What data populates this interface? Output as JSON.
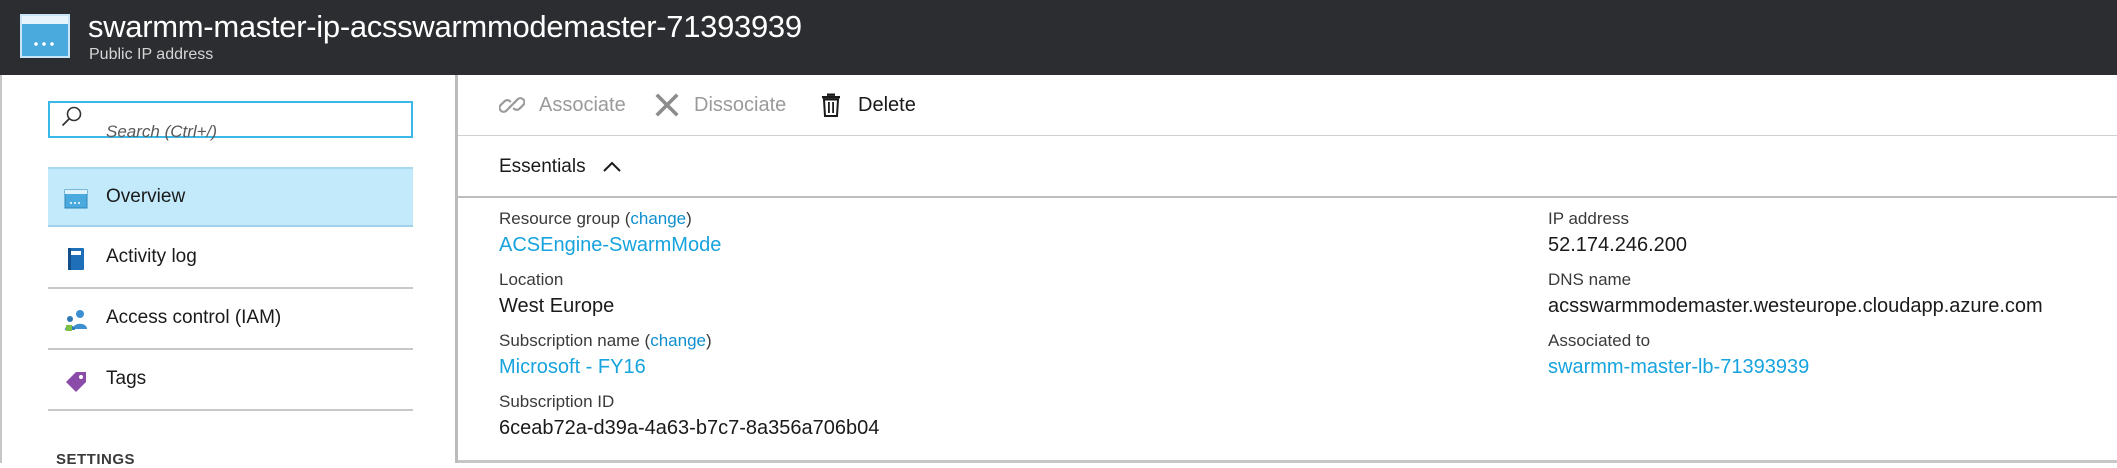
{
  "header": {
    "title": "swarmm-master-ip-acsswarmmodemaster-71393939",
    "subtitle": "Public IP address",
    "icon": "public-ip-icon"
  },
  "sidebar": {
    "search_placeholder": "Search (Ctrl+/)",
    "items": [
      {
        "label": "Overview",
        "icon": "overview-icon",
        "active": true
      },
      {
        "label": "Activity log",
        "icon": "activity-log-icon",
        "active": false
      },
      {
        "label": "Access control (IAM)",
        "icon": "access-control-icon",
        "active": false
      },
      {
        "label": "Tags",
        "icon": "tag-icon",
        "active": false
      }
    ],
    "section_label": "SETTINGS"
  },
  "toolbar": {
    "associate_label": "Associate",
    "dissociate_label": "Dissociate",
    "delete_label": "Delete"
  },
  "essentials": {
    "label": "Essentials",
    "change_text": "change",
    "left": {
      "resource_group_label": "Resource group",
      "resource_group_value": "ACSEngine-SwarmMode",
      "location_label": "Location",
      "location_value": "West Europe",
      "subscription_name_label": "Subscription name",
      "subscription_name_value": "Microsoft - FY16",
      "subscription_id_label": "Subscription ID",
      "subscription_id_value": "6ceab72a-d39a-4a63-b7c7-8a356a706b04"
    },
    "right": {
      "ip_address_label": "IP address",
      "ip_address_value": "52.174.246.200",
      "dns_name_label": "DNS name",
      "dns_name_value": "acsswarmmodemaster.westeurope.cloudapp.azure.com",
      "associated_to_label": "Associated to",
      "associated_to_value": "swarmm-master-lb-71393939"
    }
  },
  "colors": {
    "header_bg": "#2b2d31",
    "accent": "#16a3de",
    "active_nav": "#c2eafb"
  }
}
